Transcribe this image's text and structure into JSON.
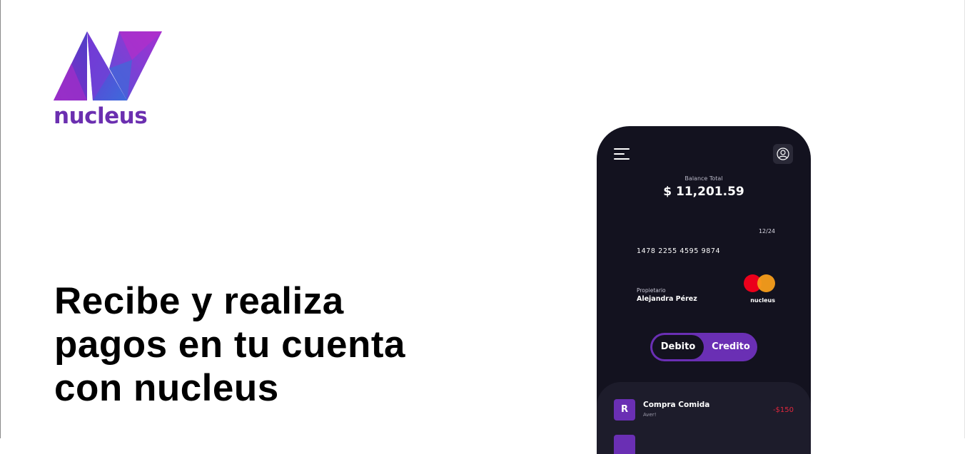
{
  "brand": {
    "logo_icon": "nucleus-logo-mark",
    "name": "nucleus",
    "primary_color": "#6b2fb0",
    "secondary_color": "#4c6bd8"
  },
  "hero": {
    "headline_line1": "Recibe y realiza",
    "headline_line2": "pagos en tu cuenta",
    "headline_line3": "con nucleus"
  },
  "phone": {
    "menu_icon": "hamburger-menu-icon",
    "profile_icon": "user-profile-icon",
    "balance_label": "Balance Total",
    "balance_amount": "$ 11,201.59",
    "card": {
      "expiry": "12/24",
      "number": "1478 2255 4595 9874",
      "owner_label": "Propietario",
      "owner_name": "Alejandra Pérez",
      "network_icon": "mastercard-icon",
      "brand": "nucleus"
    },
    "toggle": {
      "debit_label": "Debito",
      "credit_label": "Credito",
      "selected": "Debito"
    },
    "transactions": [
      {
        "initial": "R",
        "title": "Compra Comida",
        "subtitle": "Aver!",
        "amount": "-$150",
        "amount_color": "#e0273d"
      }
    ]
  }
}
